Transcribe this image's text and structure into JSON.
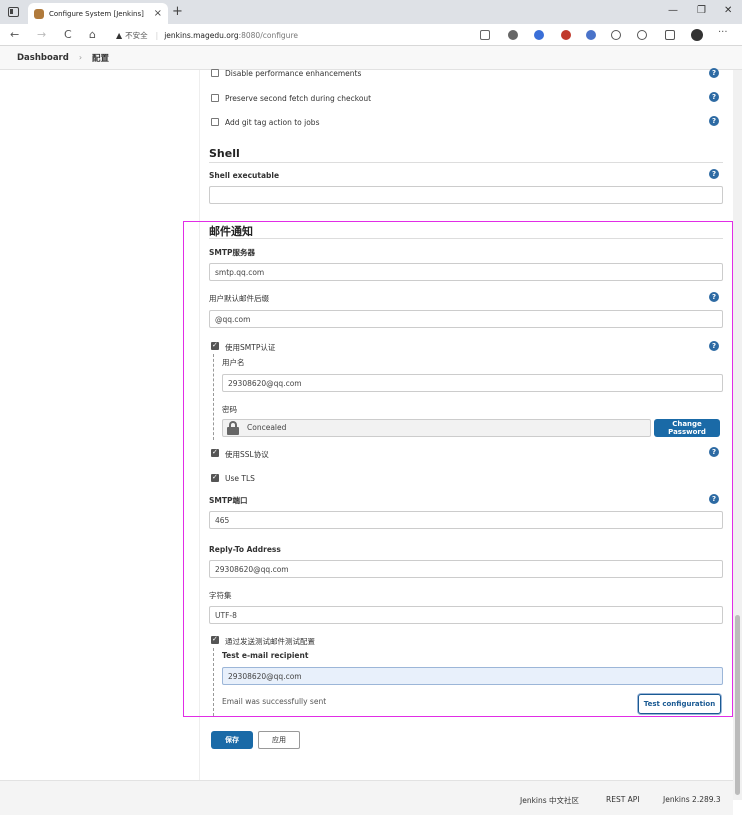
{
  "browser": {
    "tab_title": "Configure System [Jenkins]",
    "tab_close": "×",
    "new_tab": "+",
    "win_min": "—",
    "win_max": "❐",
    "win_close": "✕",
    "back": "←",
    "forward": "→",
    "reload": "C",
    "home": "⌂",
    "security_warning": "不安全",
    "url_host": "jenkins.magedu.org",
    "url_path": ":8080/configure"
  },
  "breadcrumb": {
    "items": [
      "Dashboard",
      "配置"
    ],
    "separator": "›"
  },
  "git": {
    "disable_perf": "Disable performance enhancements",
    "preserve_fetch": "Preserve second fetch during checkout",
    "add_tag": "Add git tag action to jobs"
  },
  "shell": {
    "title": "Shell",
    "executable_label": "Shell executable",
    "executable_value": ""
  },
  "mail": {
    "title": "邮件通知",
    "smtp_server_label": "SMTP服务器",
    "smtp_server_value": "smtp.qq.com",
    "suffix_label": "用户默认邮件后缀",
    "suffix_value": "@qq.com",
    "use_smtp_auth": "使用SMTP认证",
    "username_label": "用户名",
    "username_value": "29308620@qq.com",
    "password_label": "密码",
    "password_value": "Concealed",
    "change_password": "Change Password",
    "use_ssl": "使用SSL协议",
    "use_tls": "Use TLS",
    "smtp_port_label": "SMTP端口",
    "smtp_port_value": "465",
    "reply_to_label": "Reply-To Address",
    "reply_to_value": "29308620@qq.com",
    "charset_label": "字符集",
    "charset_value": "UTF-8",
    "test_config_label": "通过发送测试邮件测试配置",
    "test_recipient_label": "Test e-mail recipient",
    "test_recipient_value": "29308620@qq.com",
    "test_result": "Email was successfully sent",
    "test_button": "Test configuration"
  },
  "actions": {
    "save": "保存",
    "apply": "应用"
  },
  "help_glyph": "?",
  "footer": {
    "community": "Jenkins 中文社区",
    "rest_api": "REST API",
    "version": "Jenkins 2.289.3"
  },
  "colors": {
    "highlight": "#e12de6",
    "primary": "#1a6aa7",
    "help": "#2d6aa3"
  }
}
